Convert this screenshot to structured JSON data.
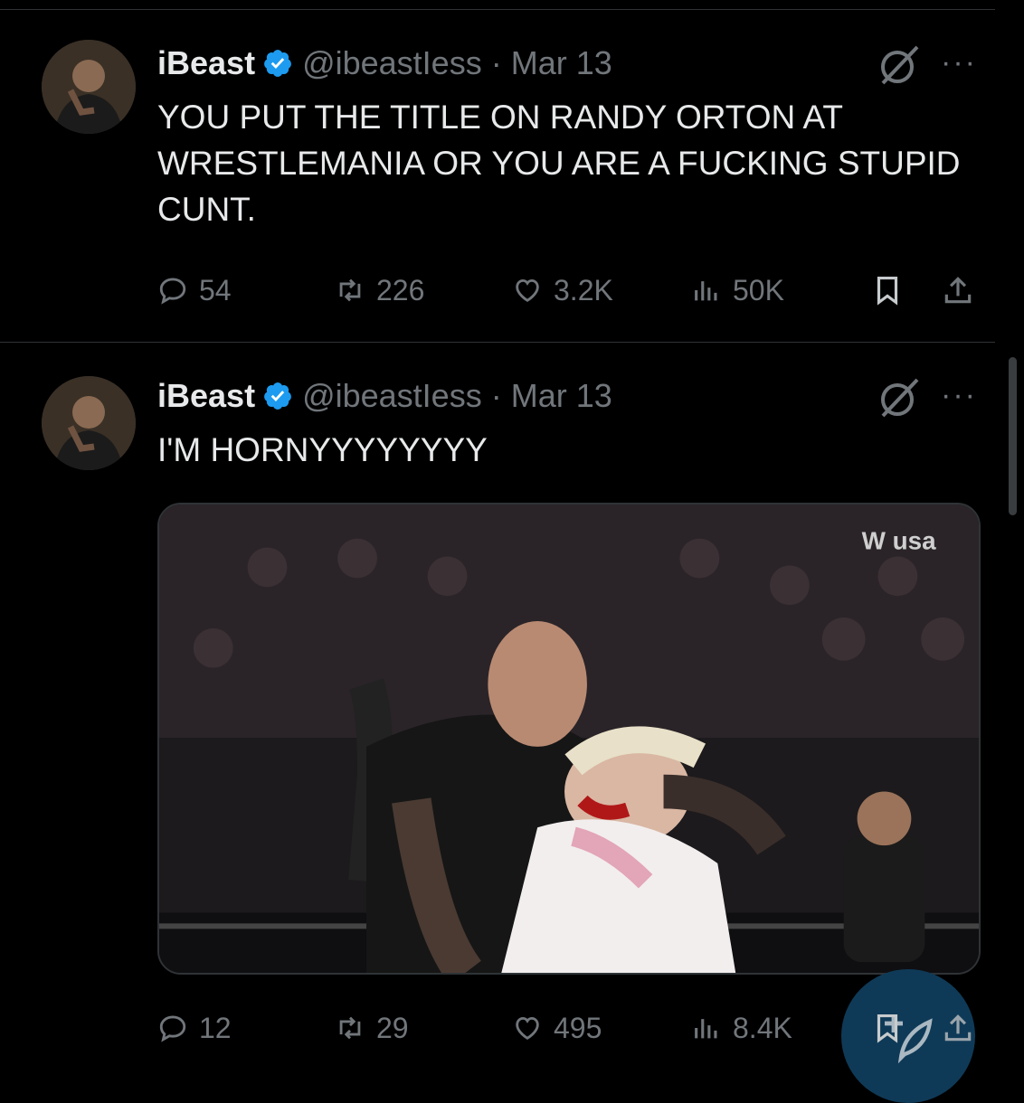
{
  "tweets": [
    {
      "name": "iBeast",
      "handle": "@ibeastIess",
      "separator": "·",
      "date": "Mar 13",
      "more": "···",
      "text": "YOU PUT THE TITLE ON RANDY ORTON AT WRESTLEMANIA OR YOU ARE A FUCKING STUPID CUNT.",
      "replies": "54",
      "reposts": "226",
      "likes": "3.2K",
      "views": "50K"
    },
    {
      "name": "iBeast",
      "handle": "@ibeastIess",
      "separator": "·",
      "date": "Mar 13",
      "more": "···",
      "text": "I'M HORNYYYYYYYY",
      "media_description": "video",
      "replies": "12",
      "reposts": "29",
      "likes": "495",
      "views": "8.4K"
    }
  ],
  "icons": {
    "verified": "verified-badge-icon",
    "grok": "grok-icon",
    "reply": "reply-icon",
    "repost": "repost-icon",
    "like": "like-icon",
    "views": "views-icon",
    "bookmark": "bookmark-icon",
    "share": "share-icon",
    "compose": "compose-icon"
  },
  "colors": {
    "background": "#000000",
    "text": "#e7e9ea",
    "muted": "#71767b",
    "verified": "#1d9bf0",
    "fab": "#0f3a57"
  }
}
